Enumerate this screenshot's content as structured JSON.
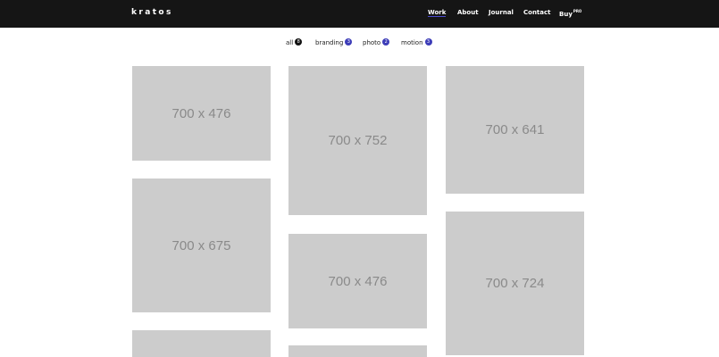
{
  "brand": {
    "logo": "kratos"
  },
  "nav": {
    "items": [
      {
        "label": "Work",
        "active": true
      },
      {
        "label": "About"
      },
      {
        "label": "Journal"
      },
      {
        "label": "Contact"
      },
      {
        "label": "Buy",
        "badge": "PRO"
      }
    ]
  },
  "filters": [
    {
      "label": "all",
      "count": "8",
      "active": true
    },
    {
      "label": "branding",
      "count": "3"
    },
    {
      "label": "photo",
      "count": "2"
    },
    {
      "label": "motion",
      "count": "3"
    }
  ],
  "gallery": {
    "items": [
      {
        "label": "700 x 476"
      },
      {
        "label": "700 x 675"
      },
      {
        "label": ""
      },
      {
        "label": "700 x 752"
      },
      {
        "label": "700 x 476"
      },
      {
        "label": ""
      },
      {
        "label": "700 x 641"
      },
      {
        "label": "700 x 724"
      }
    ]
  },
  "colors": {
    "navbar_bg": "#151515",
    "accent": "#3d3db8",
    "placeholder": "#cccccc",
    "placeholder_text": "#8a8a8a"
  }
}
